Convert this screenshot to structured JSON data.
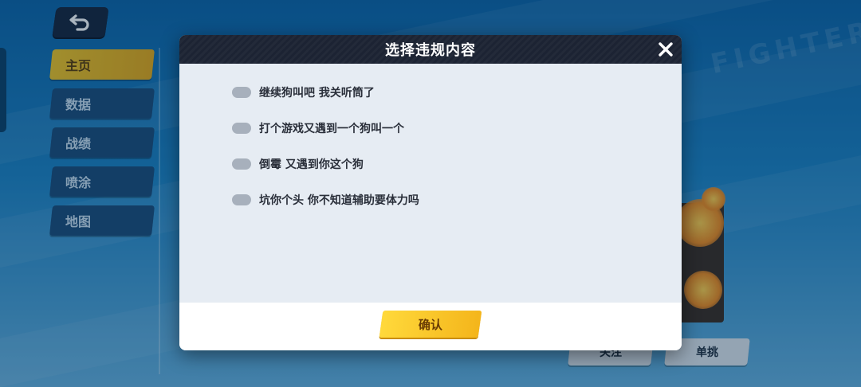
{
  "background": {
    "watermark_text": [
      "FIGHTER"
    ]
  },
  "sidebar": {
    "items": [
      {
        "label": "主页",
        "active": true
      },
      {
        "label": "数据",
        "active": false
      },
      {
        "label": "战绩",
        "active": false
      },
      {
        "label": "喷涂",
        "active": false
      },
      {
        "label": "地图",
        "active": false
      }
    ]
  },
  "bottom_buttons": {
    "follow_label": "关注",
    "duel_label": "单挑"
  },
  "dialog": {
    "title": "选择违规内容",
    "options": [
      "继续狗叫吧 我关听筒了",
      "打个游戏又遇到一个狗叫一个",
      "倒霉 又遇到你这个狗",
      "坑你个头 你不知道辅助要体力吗"
    ],
    "confirm_label": "确认"
  },
  "colors": {
    "accent": "#f4b51b",
    "dialog_header": "#1c2333",
    "dialog_body": "#e6ecf3",
    "radio_unchecked": "#a7b0bc"
  },
  "icons": {
    "back": "back-arrow-icon",
    "close": "close-icon"
  }
}
